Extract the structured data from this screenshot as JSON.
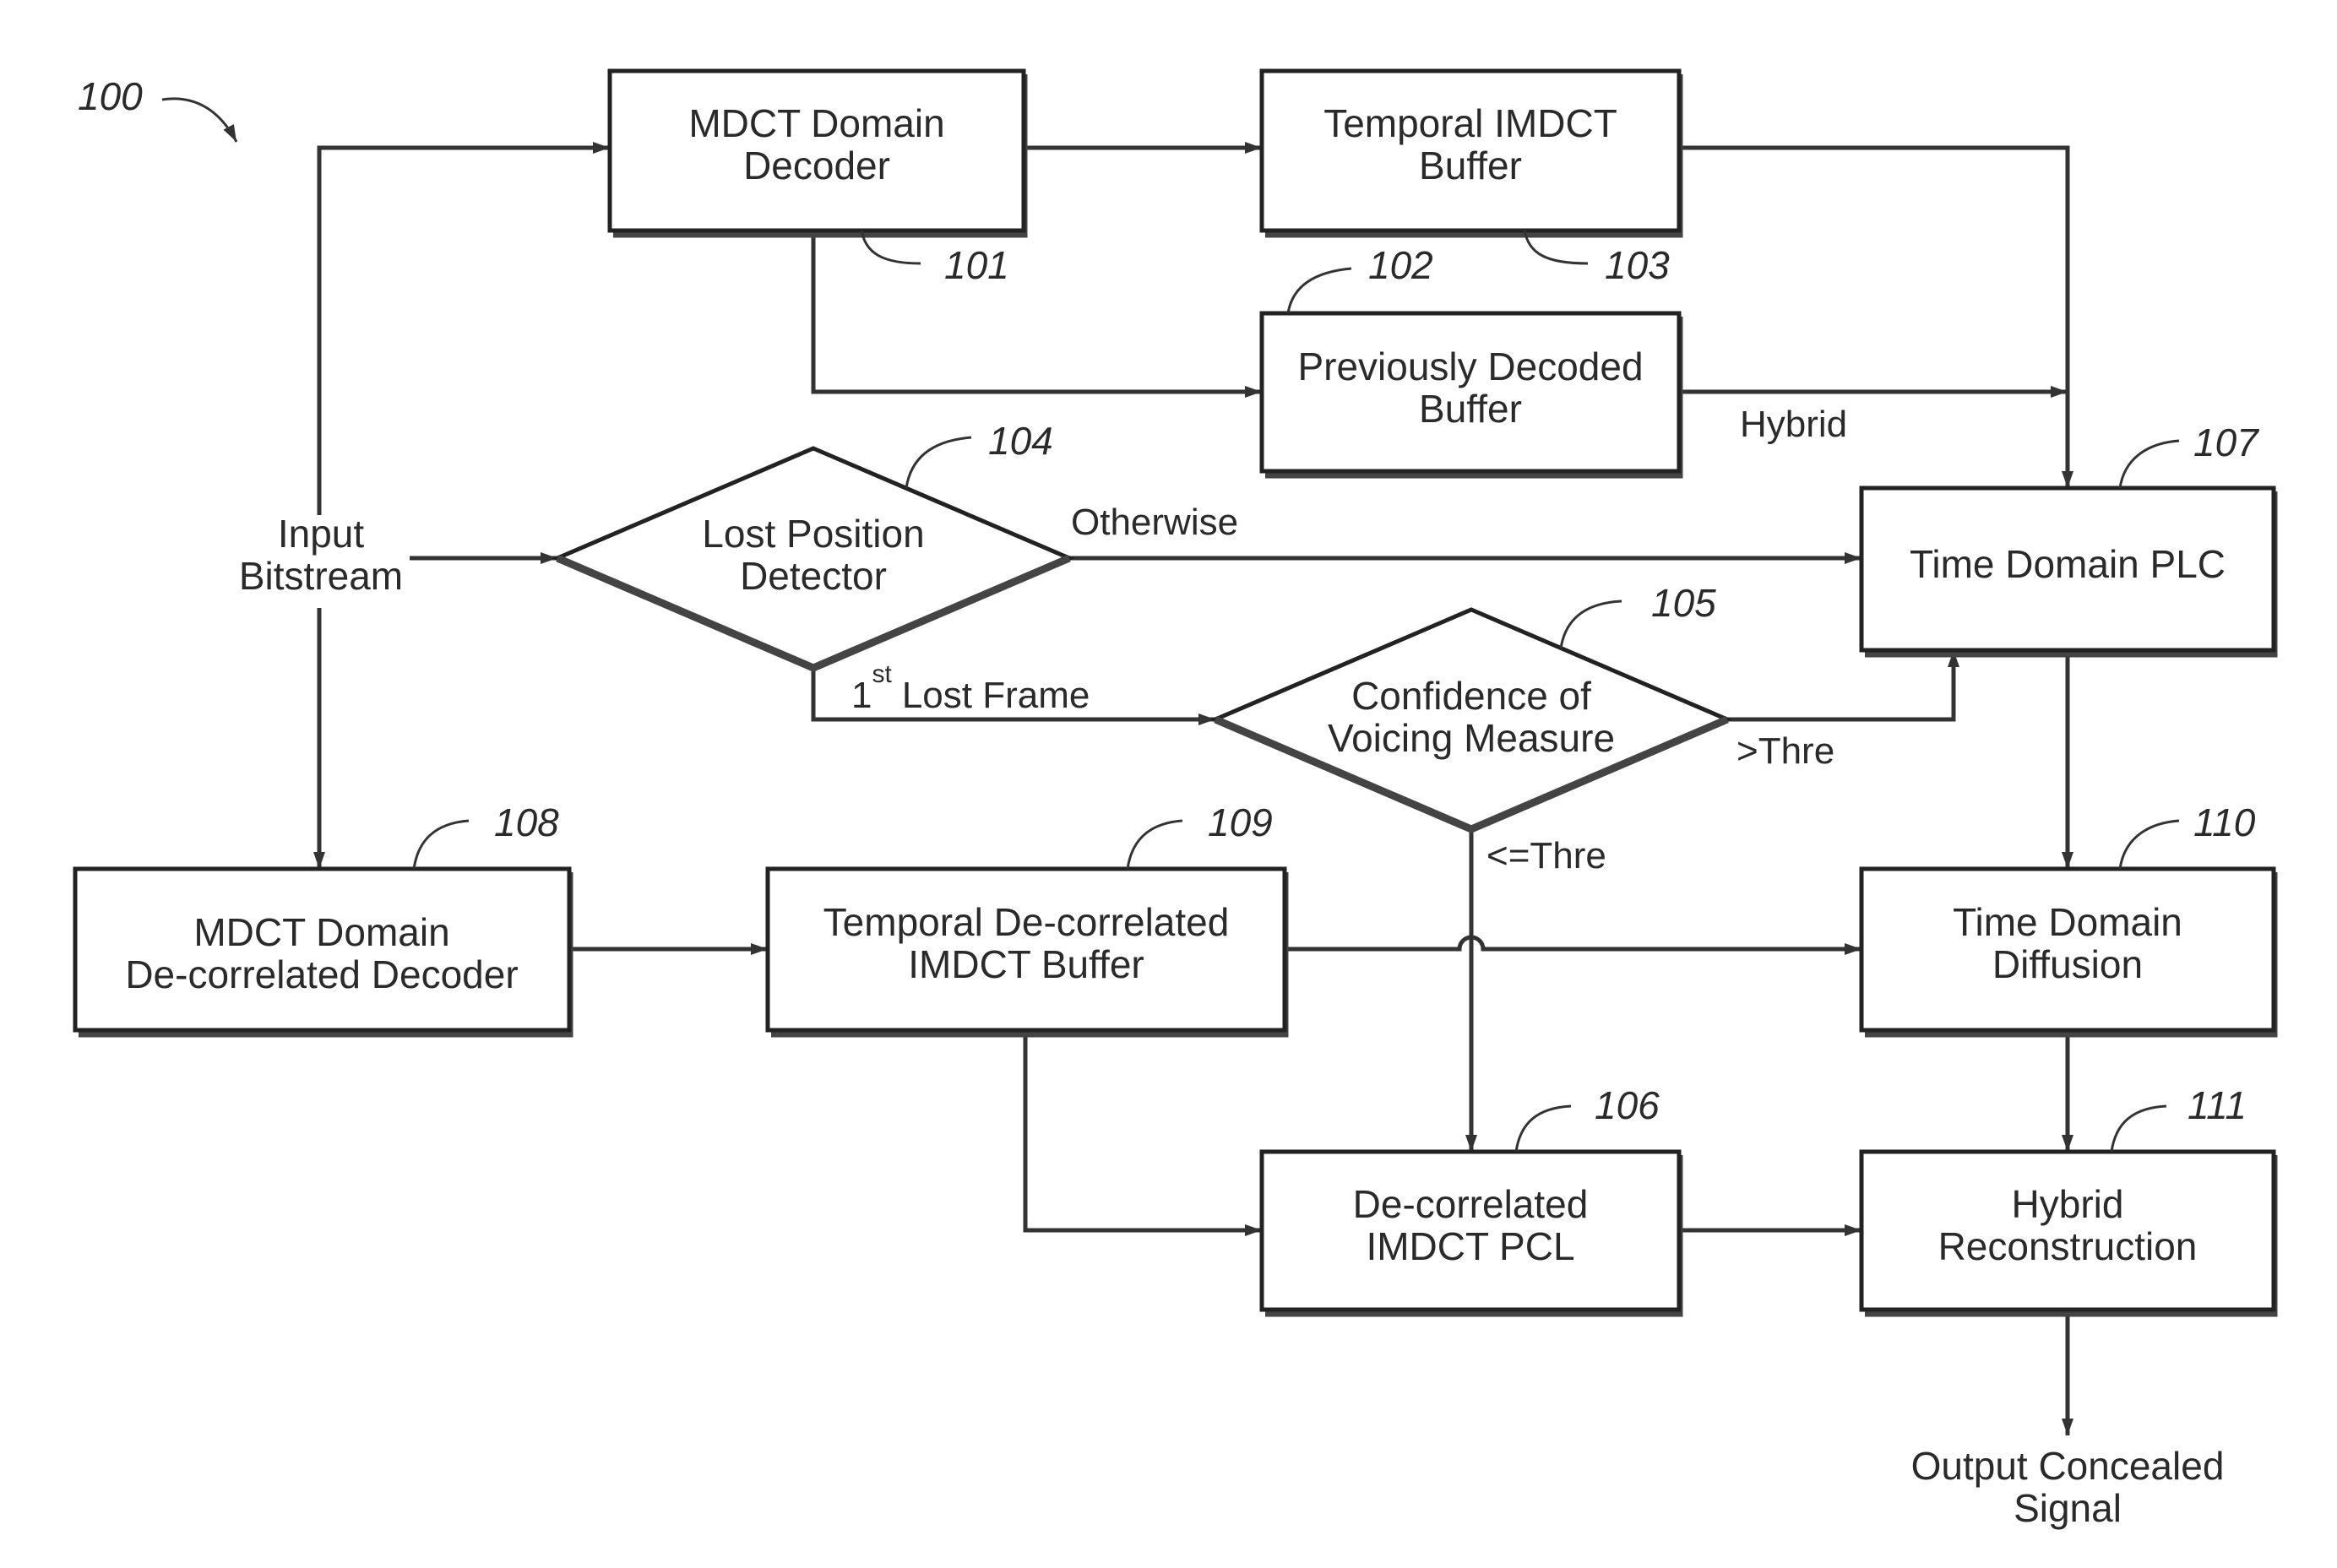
{
  "figure_ref": "100",
  "nodes": {
    "mdct_decoder": {
      "ref": "101",
      "lines": [
        "MDCT Domain",
        "Decoder"
      ]
    },
    "prev_decoded_buffer": {
      "ref": "102",
      "lines": [
        "Previously Decoded",
        "Buffer"
      ]
    },
    "temporal_imdct_buffer": {
      "ref": "103",
      "lines": [
        "Temporal IMDCT",
        "Buffer"
      ]
    },
    "lost_position_detector": {
      "ref": "104",
      "lines": [
        "Lost Position",
        "Detector"
      ]
    },
    "confidence_voicing": {
      "ref": "105",
      "lines": [
        "Confidence of",
        "Voicing Measure"
      ]
    },
    "decorrelated_imdct_pcl": {
      "ref": "106",
      "lines": [
        "De-correlated",
        "IMDCT PCL"
      ]
    },
    "time_domain_plc": {
      "ref": "107",
      "lines": [
        "Time Domain PLC"
      ]
    },
    "mdct_decorrelated_decoder": {
      "ref": "108",
      "lines": [
        "MDCT Domain",
        "De-correlated Decoder"
      ]
    },
    "temporal_decorrelated_buffer": {
      "ref": "109",
      "lines": [
        "Temporal De-correlated",
        "IMDCT Buffer"
      ]
    },
    "time_domain_diffusion": {
      "ref": "110",
      "lines": [
        "Time Domain",
        "Diffusion"
      ]
    },
    "hybrid_reconstruction": {
      "ref": "111",
      "lines": [
        "Hybrid",
        "Reconstruction"
      ]
    }
  },
  "io": {
    "input": [
      "Input",
      "Bitstream"
    ],
    "output": [
      "Output Concealed",
      "Signal"
    ]
  },
  "edge_labels": {
    "hybrid": "Hybrid",
    "otherwise": "Otherwise",
    "first_lost_num": "1",
    "first_lost_sup": "st",
    "first_lost_rest": "Lost Frame",
    "gt_thre": ">Thre",
    "le_thre": "<=Thre"
  }
}
